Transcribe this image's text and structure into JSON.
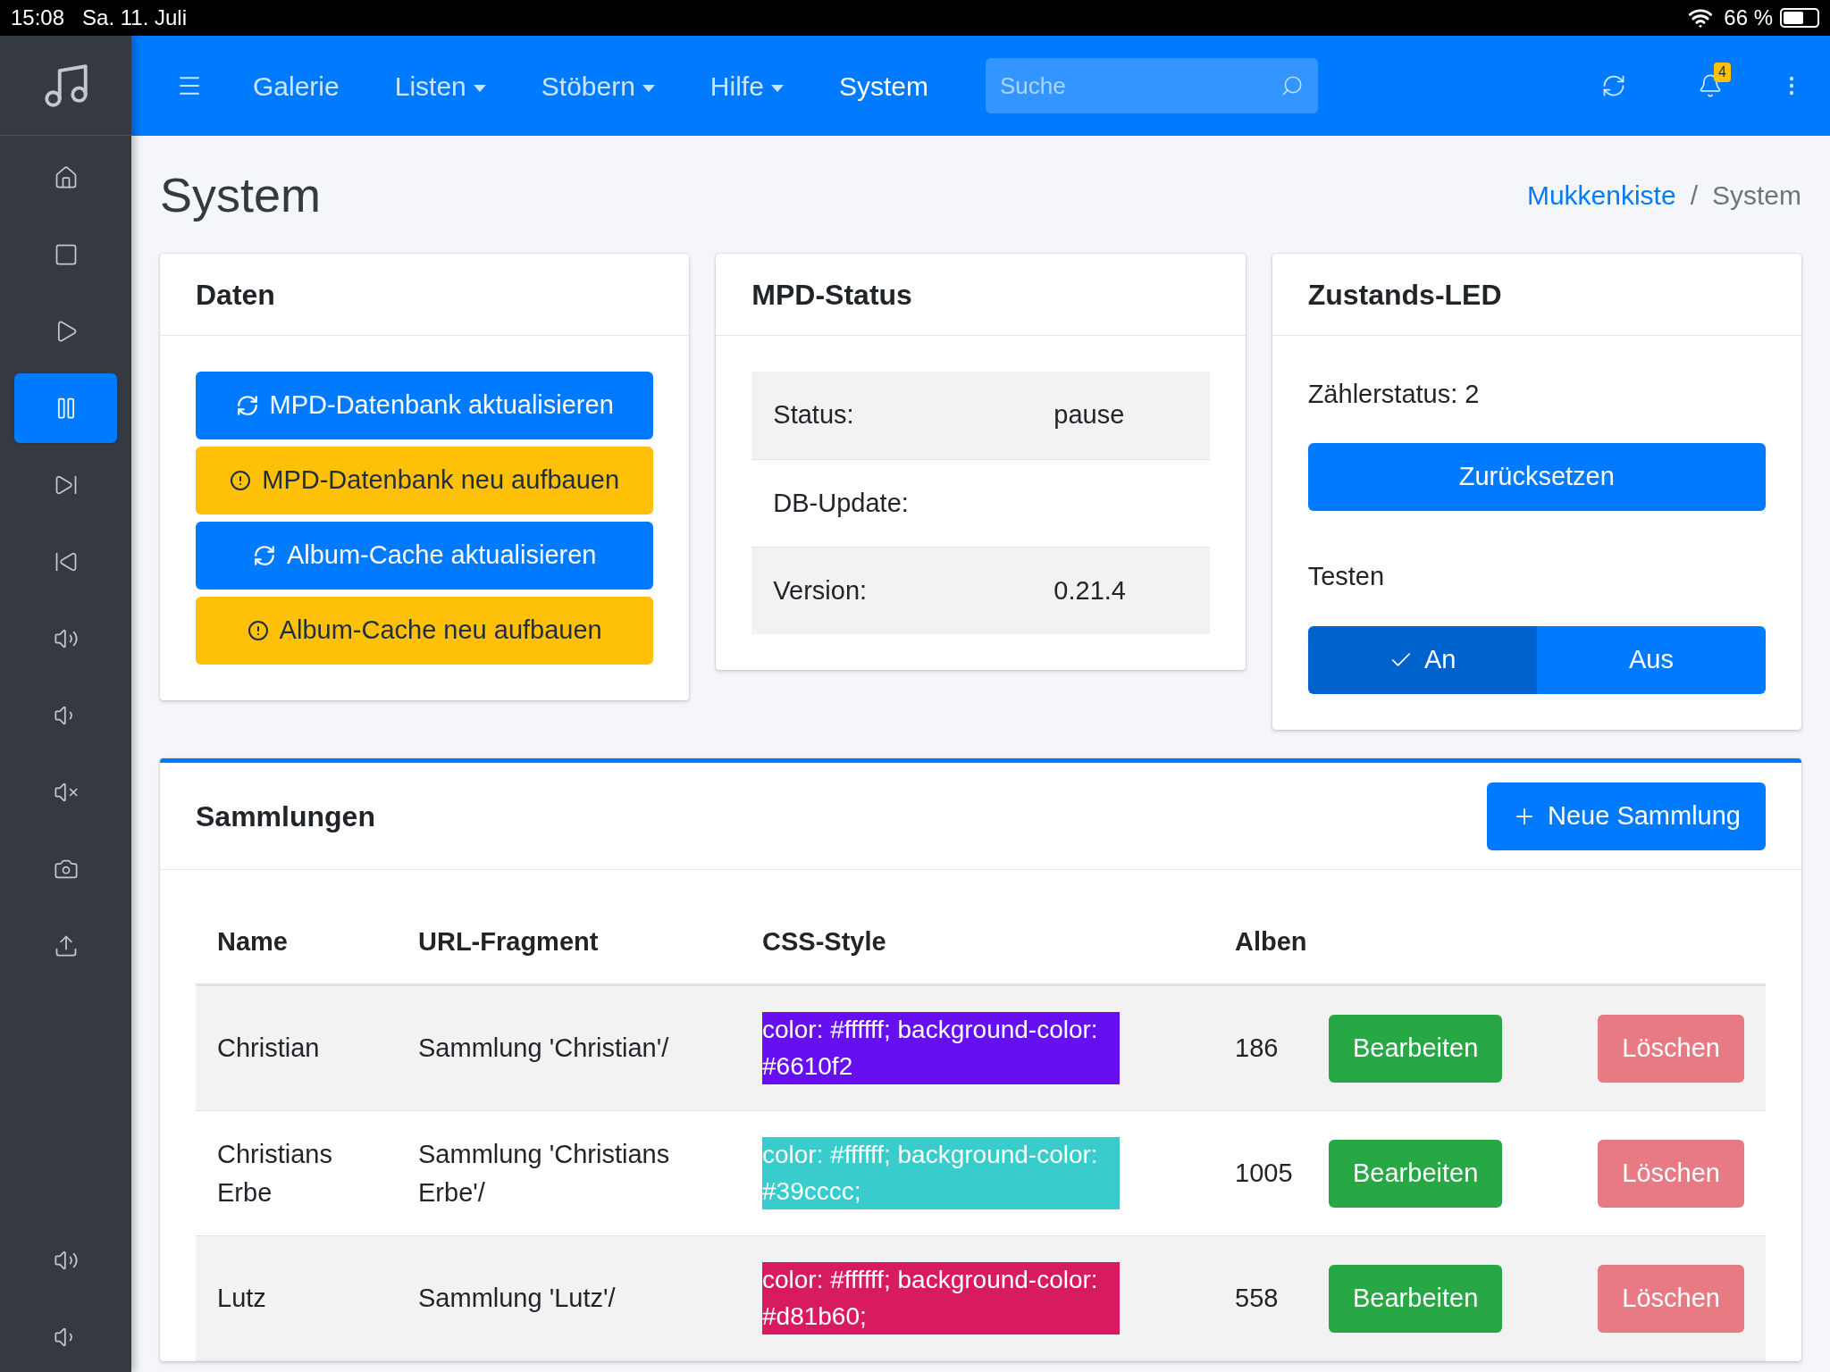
{
  "status_bar": {
    "time": "15:08",
    "date": "Sa. 11. Juli",
    "battery": "66 %"
  },
  "navbar": {
    "menu": [
      {
        "label": "Galerie",
        "dropdown": false,
        "selected": false
      },
      {
        "label": "Listen",
        "dropdown": true,
        "selected": false
      },
      {
        "label": "Stöbern",
        "dropdown": true,
        "selected": false
      },
      {
        "label": "Hilfe",
        "dropdown": true,
        "selected": false
      },
      {
        "label": "System",
        "dropdown": false,
        "selected": true
      }
    ],
    "search": {
      "placeholder": "Suche"
    },
    "notification_badge": "4"
  },
  "sidebar": {
    "items": [
      {
        "kind": "home",
        "selected": false
      },
      {
        "kind": "stop",
        "selected": false
      },
      {
        "kind": "play",
        "selected": false
      },
      {
        "kind": "pause",
        "selected": true
      },
      {
        "kind": "next",
        "selected": false
      },
      {
        "kind": "previous",
        "selected": false
      },
      {
        "kind": "volume-up",
        "selected": false
      },
      {
        "kind": "volume-down",
        "selected": false
      },
      {
        "kind": "mute",
        "selected": false
      },
      {
        "kind": "camera",
        "selected": false
      },
      {
        "kind": "upload",
        "selected": false
      }
    ],
    "bottom_items": [
      {
        "kind": "volume-up",
        "selected": false
      },
      {
        "kind": "volume-down",
        "selected": false
      }
    ]
  },
  "page": {
    "title": "System",
    "breadcrumb_separator": "/",
    "breadcrumb": [
      {
        "label": "Mukkenkiste",
        "kind": "link"
      },
      {
        "label": "System",
        "kind": "current"
      }
    ]
  },
  "data_card": {
    "title": "Daten",
    "buttons": [
      {
        "kind": "update",
        "label": "MPD-Datenbank aktualisieren"
      },
      {
        "kind": "rebuild",
        "label": "MPD-Datenbank neu aufbauen"
      },
      {
        "kind": "update",
        "label": "Album-Cache aktualisieren"
      },
      {
        "kind": "rebuild",
        "label": "Album-Cache neu aufbauen"
      }
    ]
  },
  "mpd_card": {
    "title": "MPD-Status",
    "rows": [
      {
        "label": "Status:",
        "value": "pause"
      },
      {
        "label": "DB-Update:"
      },
      {
        "label": "Version:",
        "value": "0.21.4"
      }
    ]
  },
  "led_card": {
    "title": "Zustands-LED",
    "counter": "Zählerstatus: 2",
    "reset_button": "Zurücksetzen",
    "test_label": "Testen",
    "toggle": [
      {
        "label": "An",
        "selected": true
      },
      {
        "label": "Aus",
        "selected": false
      }
    ]
  },
  "collections": {
    "title": "Sammlungen",
    "new_button": "Neue Sammlung",
    "columns": [
      "Name",
      "URL-Fragment",
      "CSS-Style",
      "Alben"
    ],
    "rows": [
      {
        "name": "Christian",
        "url": "Sammlung 'Christian'/",
        "css": "color: #ffffff; background-color: #6610f2",
        "color": "#6610f2",
        "albums": "186",
        "edit": "Bearbeiten",
        "delete": "Löschen",
        "delete_disabled": true
      },
      {
        "name": "Christians Erbe",
        "url": "Sammlung 'Christians Erbe'/",
        "css": "color: #ffffff; background-color: #39cccc;",
        "color": "#39cccc",
        "albums": "1005",
        "edit": "Bearbeiten",
        "delete": "Löschen",
        "delete_disabled": true
      },
      {
        "name": "Lutz",
        "url": "Sammlung 'Lutz'/",
        "css": "color: #ffffff; background-color: #d81b60;",
        "color": "#d81b60",
        "albums": "558",
        "edit": "Bearbeiten",
        "delete": "Löschen",
        "delete_disabled": true
      }
    ]
  }
}
